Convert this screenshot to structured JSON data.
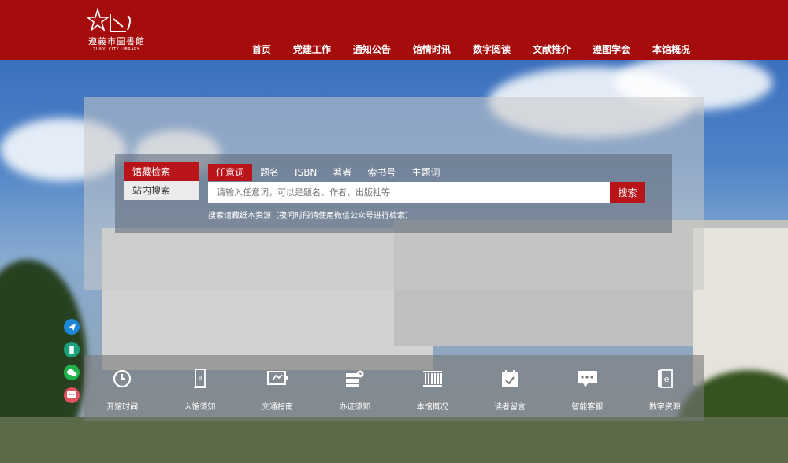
{
  "logo": {
    "name": "遵義市圖書館",
    "subtitle": "ZUNYI CITY LIBRARY"
  },
  "nav": [
    "首页",
    "党建工作",
    "通知公告",
    "馆情时讯",
    "数字阅读",
    "文献推介",
    "遵图学会",
    "本馆概况"
  ],
  "search": {
    "side_tabs": [
      "馆藏检索",
      "站内搜索"
    ],
    "field_tabs": [
      "任意词",
      "题名",
      "ISBN",
      "著者",
      "索书号",
      "主题词"
    ],
    "placeholder": "请输入任意词，可以是题名、作者、出版社等",
    "button_label": "搜索",
    "hint": "搜索馆藏纸本资源（夜间时段请使用微信公众号进行检索）"
  },
  "float_icons": [
    "telegram-icon",
    "app-icon",
    "wechat-icon",
    "message-icon"
  ],
  "quick_links": [
    {
      "label": "开馆时间",
      "icon": "clock-icon"
    },
    {
      "label": "入馆须知",
      "icon": "door-icon"
    },
    {
      "label": "交通指南",
      "icon": "transport-icon"
    },
    {
      "label": "办证须知",
      "icon": "card-icon"
    },
    {
      "label": "本馆概况",
      "icon": "building-icon"
    },
    {
      "label": "读者留言",
      "icon": "calendar-check-icon"
    },
    {
      "label": "智能客服",
      "icon": "chat-icon"
    },
    {
      "label": "数字资源",
      "icon": "ebook-icon"
    }
  ],
  "colors": {
    "header": "#a50d0d",
    "accent": "#b9141a"
  }
}
